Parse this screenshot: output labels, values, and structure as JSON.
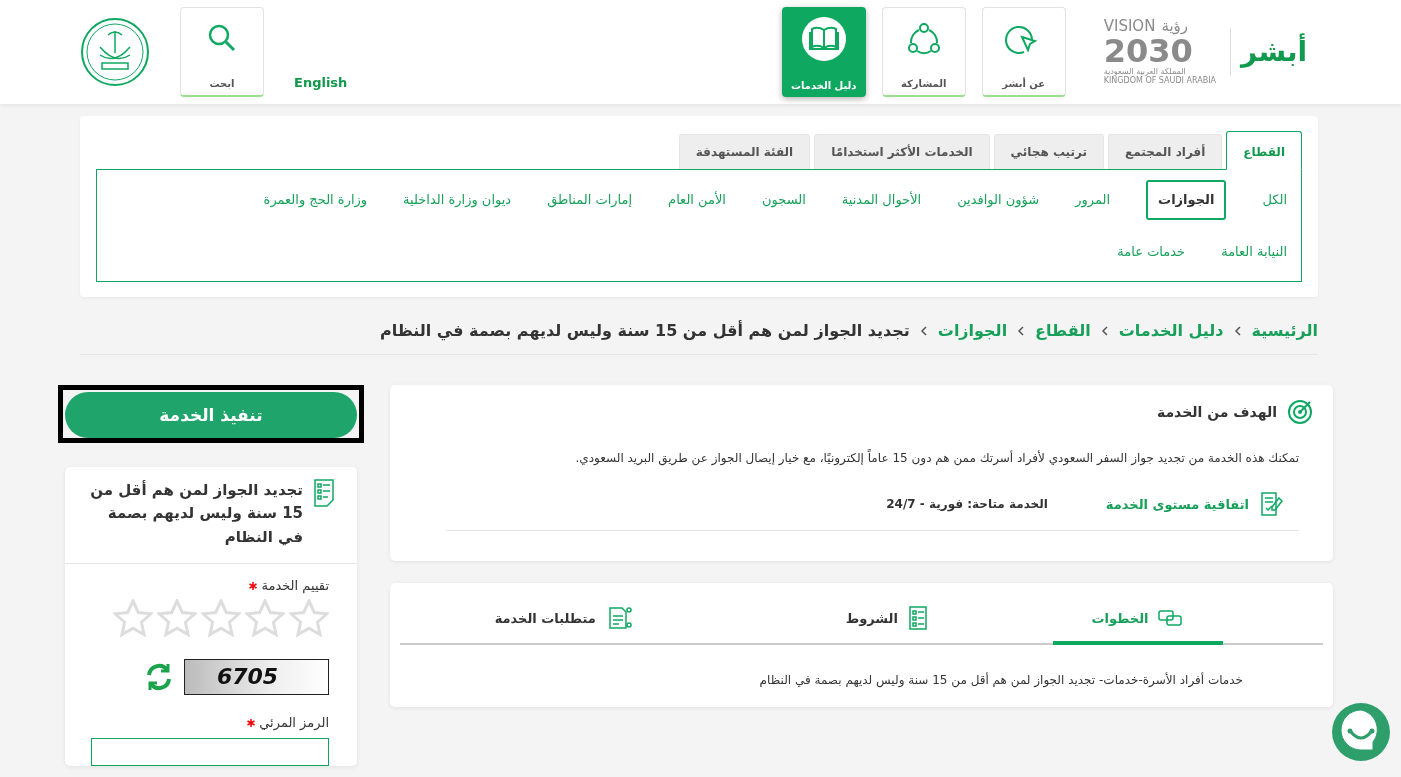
{
  "header": {
    "absher_logo": "أبشر",
    "vision_logo": {
      "word_ar": "رؤية",
      "word_en": "VISION",
      "year": "2030",
      "country_ar": "المملكة العربية السعودية",
      "country_en": "KINGDOM OF SAUDI ARABIA"
    },
    "nav": [
      {
        "label": "عن أبشر",
        "selected": false
      },
      {
        "label": "المشاركة",
        "selected": false
      },
      {
        "label": "دليل الخدمات",
        "selected": true
      }
    ],
    "language": "English",
    "search": "ابحث"
  },
  "filter": {
    "tabs": [
      {
        "label": "القطاع",
        "selected": true
      },
      {
        "label": "أفراد المجتمع",
        "selected": false
      },
      {
        "label": "ترتيب هجائي",
        "selected": false
      },
      {
        "label": "الخدمات الأكثر استخدامًا",
        "selected": false
      },
      {
        "label": "الفئة المستهدفة",
        "selected": false
      }
    ],
    "items": [
      {
        "label": "الكل",
        "selected": false
      },
      {
        "label": "الجوازات",
        "selected": true
      },
      {
        "label": "المرور",
        "selected": false
      },
      {
        "label": "شؤون الوافدين",
        "selected": false
      },
      {
        "label": "الأحوال المدنية",
        "selected": false
      },
      {
        "label": "السجون",
        "selected": false
      },
      {
        "label": "الأمن العام",
        "selected": false
      },
      {
        "label": "إمارات المناطق",
        "selected": false
      },
      {
        "label": "ديوان وزارة الداخلية",
        "selected": false
      },
      {
        "label": "وزارة الحج والعمرة",
        "selected": false
      },
      {
        "label": "النيابة العامة",
        "selected": false
      },
      {
        "label": "خدمات عامة",
        "selected": false
      }
    ]
  },
  "breadcrumb": [
    {
      "label": "الرئيسية",
      "kind": "link"
    },
    {
      "label": "دليل الخدمات",
      "kind": "link"
    },
    {
      "label": "القطاع",
      "kind": "link"
    },
    {
      "label": "الجوازات",
      "kind": "link"
    },
    {
      "label": "تجديد الجواز لمن هم أقل من 15 سنة وليس لديهم بصمة في النظام",
      "kind": "current"
    }
  ],
  "execute_button": "تنفيذ الخدمة",
  "service_card": {
    "title": "تجديد الجواز لمن هم أقل من 15 سنة وليس لديهم بصمة في النظام",
    "rating_label": "تقييم الخدمة",
    "rating_required": true,
    "stars": 0,
    "captcha": "6705",
    "captcha_label": "الرمز المرئي",
    "captcha_required": true
  },
  "goal": {
    "title": "الهدف من الخدمة",
    "description": "تمكنك هذه الخدمة من تجديد جواز السفر السعودي لأفراد أسرتك ممن هم دون 15 عاماً إلكترونيًا، مع خيار إيصال الجواز عن طريق البريد السعودي.",
    "sla_link": "اتفاقية مستوى الخدمة",
    "availability": "الخدمة متاحة: فورية - 24/7"
  },
  "detail_tabs": [
    {
      "label": "الخطوات",
      "selected": true
    },
    {
      "label": "الشروط",
      "selected": false
    },
    {
      "label": "متطلبات الخدمة",
      "selected": false
    }
  ],
  "steps_text": "خدمات أفراد الأسرة-خدمات- تجديد الجواز لمن هم أقل من 15 سنة وليس لديهم بصمة في النظام"
}
